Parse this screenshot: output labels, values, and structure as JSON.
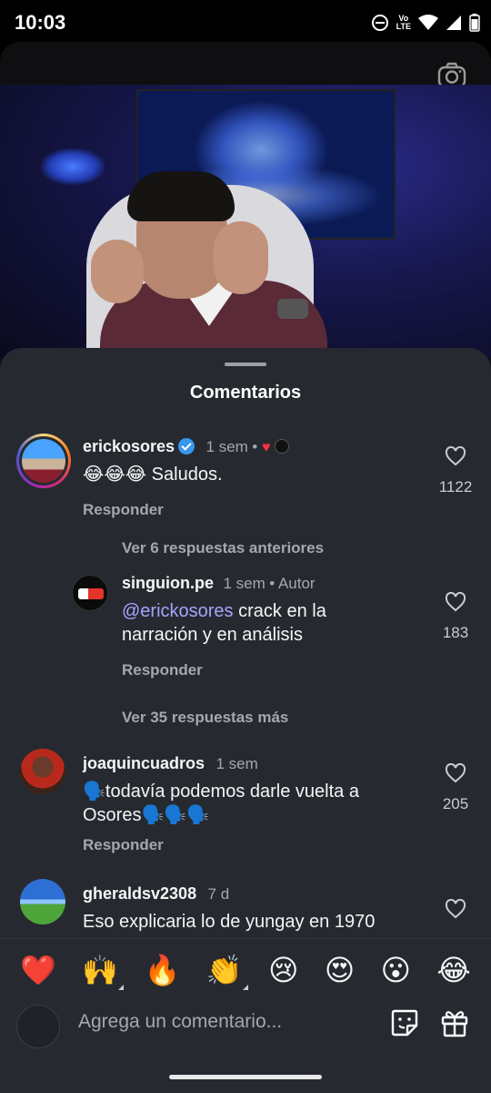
{
  "status_bar": {
    "time": "10:03",
    "volte": "Vo",
    "lte": "LTE",
    "icons": [
      "do-not-disturb-icon",
      "volte-icon",
      "wifi-icon",
      "signal-icon",
      "battery-icon"
    ]
  },
  "sheet": {
    "title": "Comentarios"
  },
  "comments": [
    {
      "username": "erickosores",
      "verified": true,
      "time": "1 sem",
      "text": "😂😂😂 Saludos.",
      "reply_label": "Responder",
      "likes": "1122"
    },
    {
      "view_replies": "Ver 6 respuestas anteriores"
    },
    {
      "username": "singuion.pe",
      "time": "1 sem",
      "author_tag": "Autor",
      "mention": "@erickosores",
      "text": " crack en la narración y en análisis",
      "reply_label": "Responder",
      "likes": "183"
    },
    {
      "view_more": "Ver 35 respuestas más"
    },
    {
      "username": "joaquincuadros",
      "time": "1 sem",
      "text": "🗣️todavía podemos darle vuelta a Osores🗣️🗣️🗣️",
      "reply_label": "Responder",
      "likes": "205"
    },
    {
      "username": "gheraldsv2308",
      "time": "7 d",
      "text": "Eso explicaria lo de yungay en 1970"
    }
  ],
  "emoji_bar": [
    "❤️",
    "🙌",
    "🔥",
    "👏",
    "😢",
    "😍",
    "😮",
    "😂"
  ],
  "composer": {
    "placeholder": "Agrega un comentario..."
  },
  "colors": {
    "sheet_bg": "#262a30",
    "secondary_text": "#a3a8b0",
    "mention": "#a7a4ff",
    "verified": "#3897f0",
    "like_red": "#ff3040"
  }
}
